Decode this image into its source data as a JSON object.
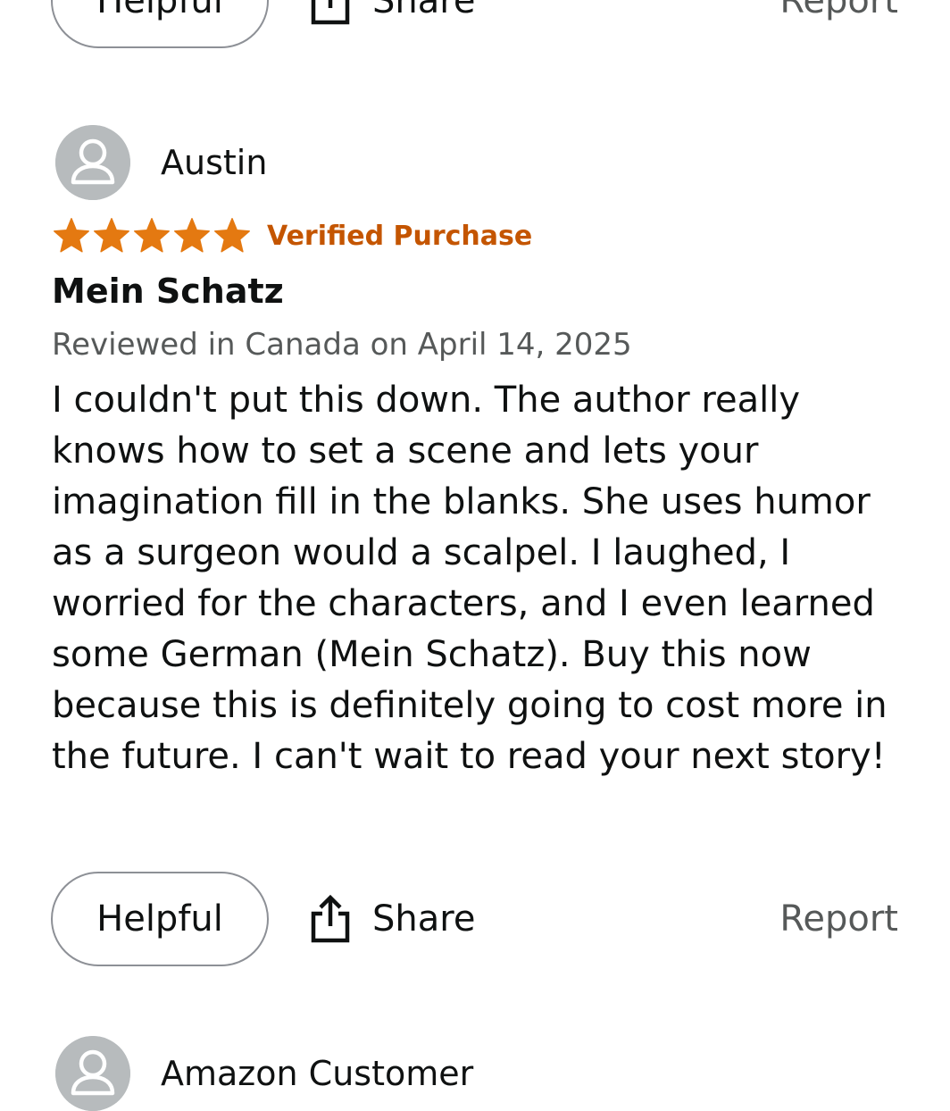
{
  "previous_review": {
    "actions": {
      "helpful_label": "Helpful",
      "share_label": "Share",
      "report_label": "Report"
    }
  },
  "review": {
    "reviewer_name": "Austin",
    "rating": 5,
    "rating_max": 5,
    "verified_label": "Verified Purchase",
    "title": "Mein Schatz",
    "meta": "Reviewed in Canada on April 14, 2025",
    "body": "I couldn't put this down. The author really knows how to set a scene and lets your imagination fill in the blanks. She uses humor as a surgeon would a scalpel. I laughed, I worried for the characters, and I even learned some German (Mein Schatz). Buy this now because this is definitely going to cost more in the future. I can't wait to read your next story!",
    "actions": {
      "helpful_label": "Helpful",
      "share_label": "Share",
      "report_label": "Report"
    }
  },
  "next_review": {
    "reviewer_name": "Amazon Customer"
  },
  "icons": {
    "avatar": "person-silhouette-icon",
    "star": "star-icon",
    "share": "share-upload-icon"
  },
  "colors": {
    "star": "#e47911",
    "verified": "#c45500",
    "avatar_bg": "#b7bbbd",
    "muted_text": "#565959",
    "button_border": "#8d9096"
  }
}
